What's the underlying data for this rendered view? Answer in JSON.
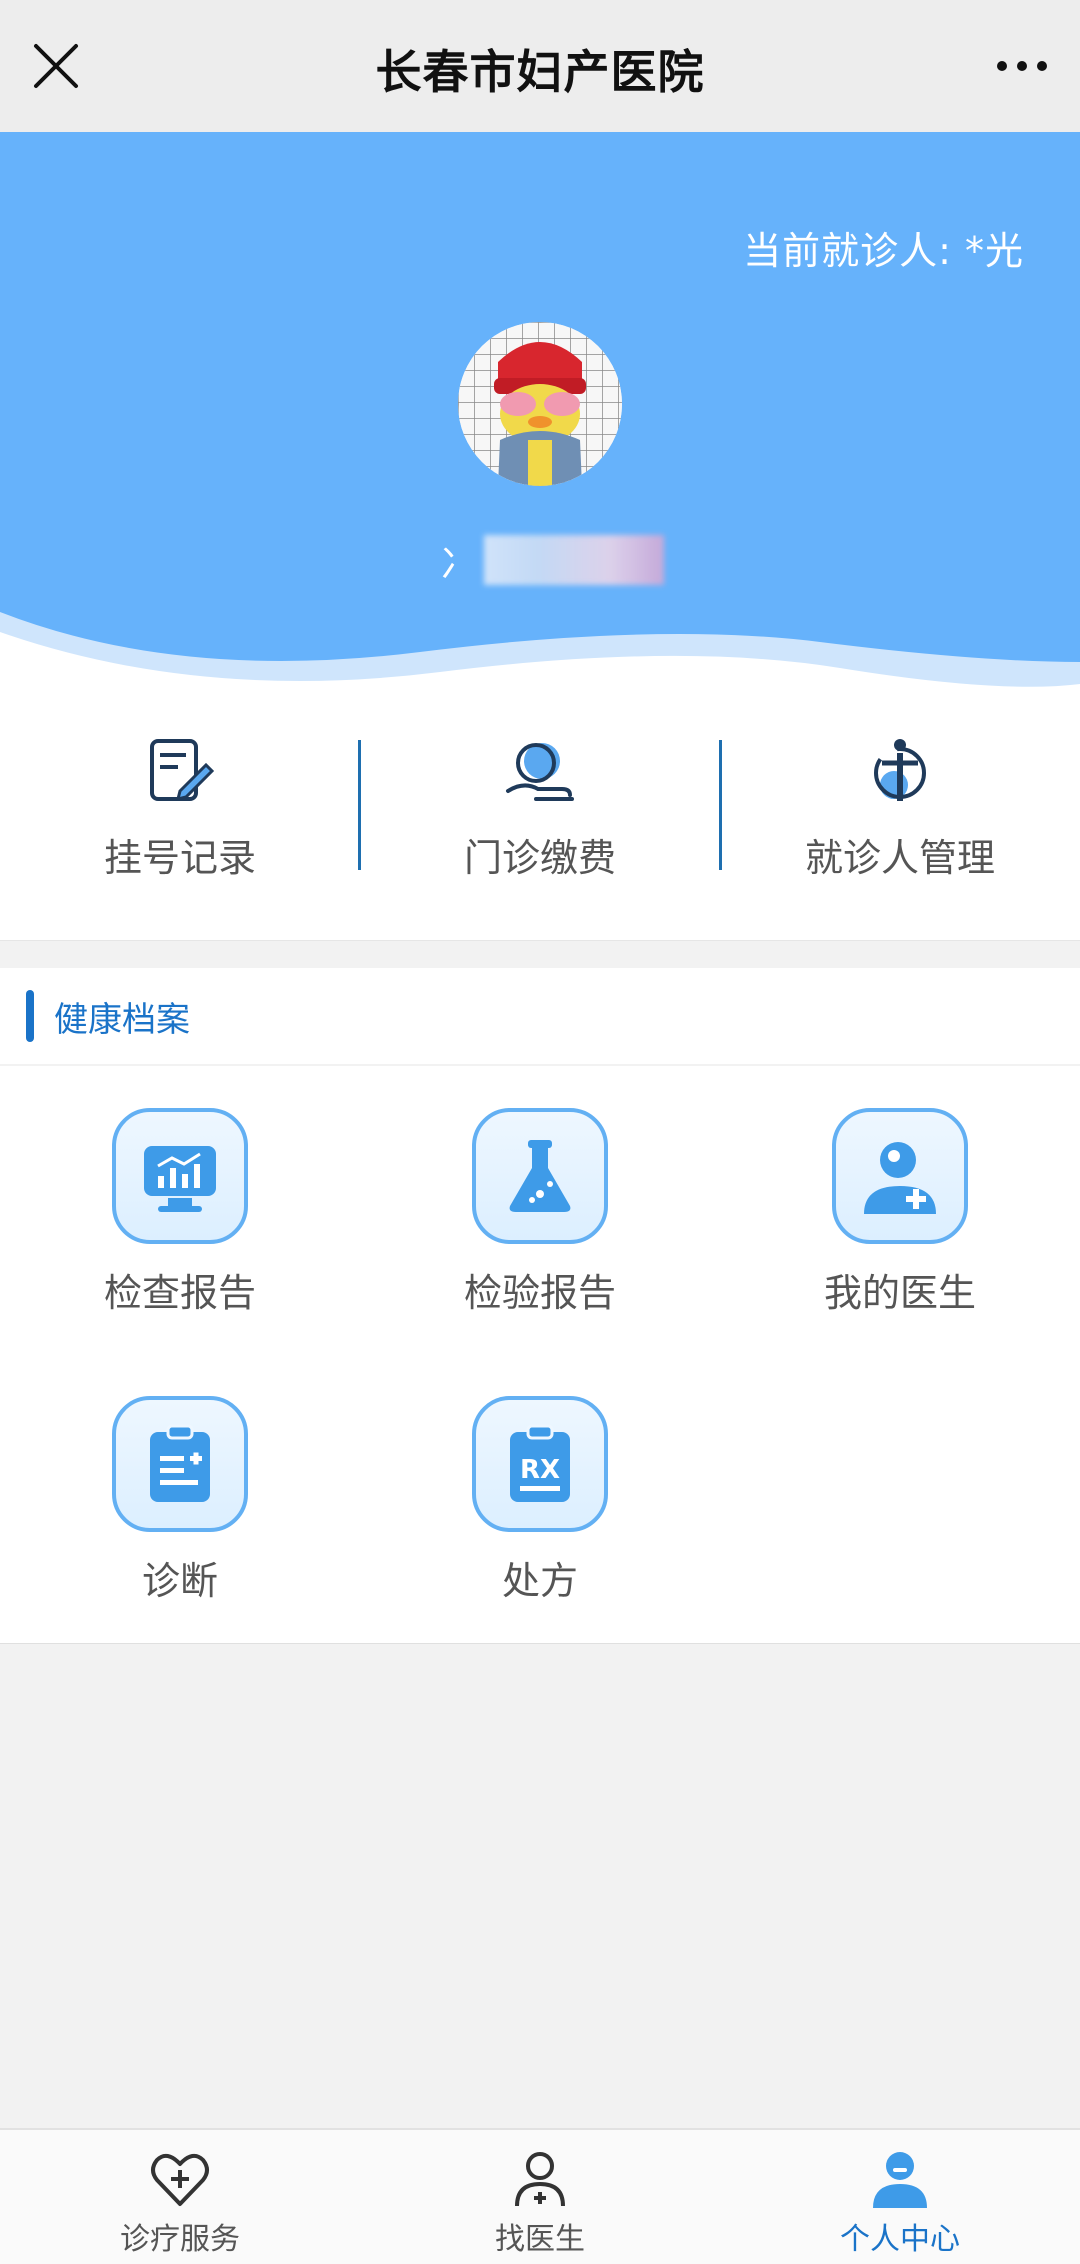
{
  "header": {
    "title": "长春市妇产医院"
  },
  "hero": {
    "current_patient": "当前就诊人: *光",
    "username_visible": "冫"
  },
  "quick_actions": [
    {
      "label": "挂号记录",
      "icon": "register-record-icon"
    },
    {
      "label": "门诊缴费",
      "icon": "outpatient-payment-icon"
    },
    {
      "label": "就诊人管理",
      "icon": "patient-management-icon"
    }
  ],
  "health_records": {
    "title": "健康档案",
    "items": [
      {
        "label": "检查报告",
        "icon": "exam-report-icon"
      },
      {
        "label": "检验报告",
        "icon": "lab-report-icon"
      },
      {
        "label": "我的医生",
        "icon": "my-doctor-icon"
      },
      {
        "label": "诊断",
        "icon": "diagnosis-icon"
      },
      {
        "label": "处方",
        "icon": "prescription-icon"
      }
    ]
  },
  "tabbar": [
    {
      "label": "诊疗服务",
      "icon": "heart-plus-icon",
      "active": false
    },
    {
      "label": "找医生",
      "icon": "find-doctor-icon",
      "active": false
    },
    {
      "label": "个人中心",
      "icon": "profile-icon",
      "active": true
    }
  ],
  "colors": {
    "hero_blue": "#66b2fb",
    "accent": "#1a73c8",
    "tile_border": "#63b0f3"
  }
}
